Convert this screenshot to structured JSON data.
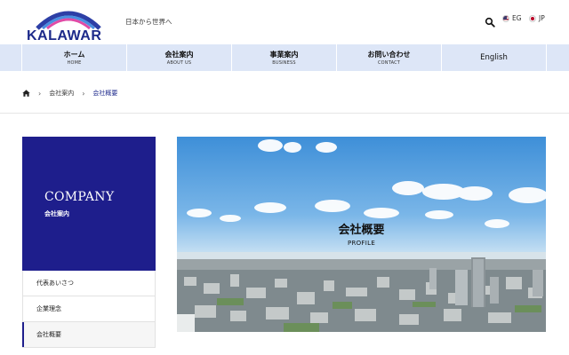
{
  "header": {
    "logo_text": "KALAWAR",
    "tagline": "日本から世界へ",
    "languages": [
      {
        "code": "EG",
        "flag": "us-flag-icon"
      },
      {
        "code": "JP",
        "flag": "jp-flag-icon"
      }
    ]
  },
  "nav": {
    "items": [
      {
        "label": "ホーム",
        "sub": "HOME"
      },
      {
        "label": "会社案内",
        "sub": "ABOUT US"
      },
      {
        "label": "事業案内",
        "sub": "BUSINESS"
      },
      {
        "label": "お問い合わせ",
        "sub": "CONTACT"
      },
      {
        "label": "English",
        "sub": ""
      }
    ]
  },
  "breadcrumb": {
    "home_icon": "home-icon",
    "items": [
      "会社案内",
      "会社概要"
    ],
    "separator": "›"
  },
  "sidebar": {
    "title": "COMPANY",
    "subtitle": "会社案内",
    "links": [
      {
        "label": "代表あいさつ",
        "active": false
      },
      {
        "label": "企業理念",
        "active": false
      },
      {
        "label": "会社概要",
        "active": true
      }
    ]
  },
  "hero": {
    "title": "会社概要",
    "subtitle": "PROFILE"
  },
  "colors": {
    "brand_navy": "#1e1e8c",
    "nav_bg": "#dde6f7",
    "logo_text": "#1d2a8a"
  }
}
